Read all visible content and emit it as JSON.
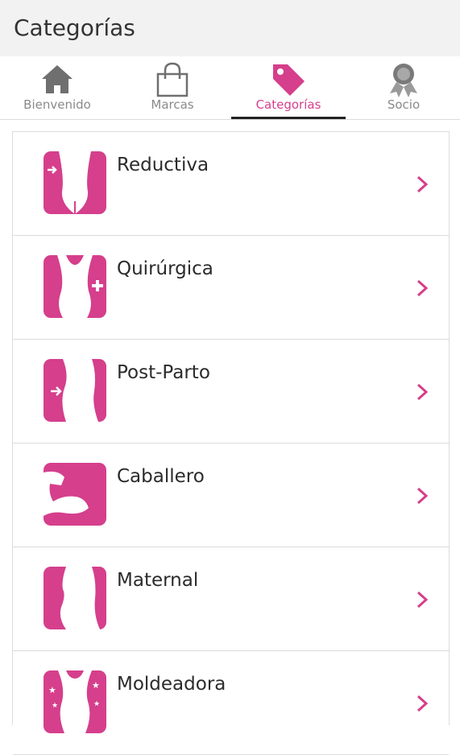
{
  "header": {
    "title": "Categorías"
  },
  "tabs": [
    {
      "label": "Bienvenido",
      "icon": "home-icon",
      "active": false
    },
    {
      "label": "Marcas",
      "icon": "shopping-bag-icon",
      "active": false
    },
    {
      "label": "Categorías",
      "icon": "tag-icon",
      "active": true
    },
    {
      "label": "Socio",
      "icon": "award-icon",
      "active": false
    }
  ],
  "categories": [
    {
      "name": "Reductiva",
      "icon": "reductive-figure-icon"
    },
    {
      "name": "Quirúrgica",
      "icon": "surgical-figure-icon"
    },
    {
      "name": "Post-Parto",
      "icon": "post-partum-figure-icon"
    },
    {
      "name": "Caballero",
      "icon": "muscle-arm-icon"
    },
    {
      "name": "Maternal",
      "icon": "maternal-figure-icon"
    },
    {
      "name": "Moldeadora",
      "icon": "shaping-figure-icon"
    }
  ],
  "colors": {
    "accent": "#d53f8c",
    "inactive": "#8a8a8a",
    "header_bg": "#f2f2f2"
  }
}
